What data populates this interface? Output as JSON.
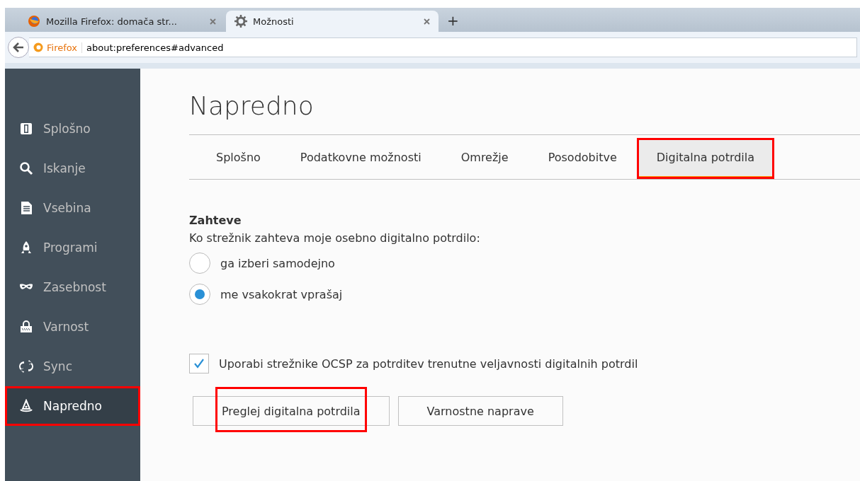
{
  "browser_tabs": [
    {
      "title": "Mozilla Firefox: domača str...",
      "selected": false,
      "kind": "firefox"
    },
    {
      "title": "Možnosti",
      "selected": true,
      "kind": "gear"
    }
  ],
  "new_tab": "+",
  "address_bar": {
    "identity": "Firefox",
    "url": "about:preferences#advanced"
  },
  "sidebar": {
    "items": [
      {
        "label": "Splošno",
        "selected": false,
        "highlighted": false
      },
      {
        "label": "Iskanje",
        "selected": false,
        "highlighted": false
      },
      {
        "label": "Vsebina",
        "selected": false,
        "highlighted": false
      },
      {
        "label": "Programi",
        "selected": false,
        "highlighted": false
      },
      {
        "label": "Zasebnost",
        "selected": false,
        "highlighted": false
      },
      {
        "label": "Varnost",
        "selected": false,
        "highlighted": false
      },
      {
        "label": "Sync",
        "selected": false,
        "highlighted": false
      },
      {
        "label": "Napredno",
        "selected": true,
        "highlighted": true
      }
    ]
  },
  "heading": "Napredno",
  "tabs": [
    {
      "label": "Splošno",
      "selected": false,
      "highlighted": false
    },
    {
      "label": "Podatkovne možnosti",
      "selected": false,
      "highlighted": false
    },
    {
      "label": "Omrežje",
      "selected": false,
      "highlighted": false
    },
    {
      "label": "Posodobitve",
      "selected": false,
      "highlighted": false
    },
    {
      "label": "Digitalna potrdila",
      "selected": true,
      "highlighted": true
    }
  ],
  "section": {
    "title": "Zahteve",
    "question": "Ko strežnik zahteva moje osebno digitalno potrdilo:",
    "options": [
      {
        "label": "ga izberi samodejno",
        "selected": false
      },
      {
        "label": "me vsakokrat vprašaj",
        "selected": true
      }
    ]
  },
  "ocsp": {
    "label": "Uporabi strežnike OCSP za potrditev trenutne veljavnosti digitalnih potrdil",
    "checked": true
  },
  "buttons": [
    {
      "label": "Preglej digitalna potrdila",
      "highlighted": true
    },
    {
      "label": "Varnostne naprave",
      "highlighted": false
    }
  ]
}
